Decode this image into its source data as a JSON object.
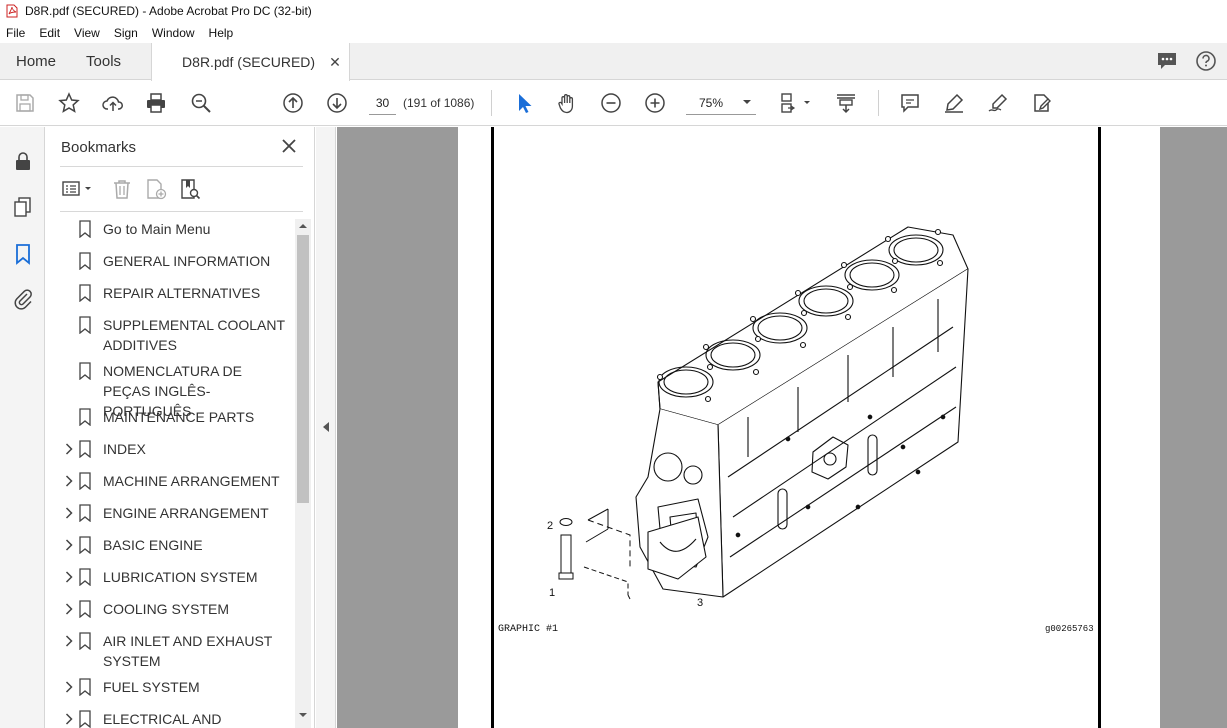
{
  "window": {
    "title": "D8R.pdf (SECURED) - Adobe Acrobat Pro DC (32-bit)"
  },
  "menu": [
    "File",
    "Edit",
    "View",
    "Sign",
    "Window",
    "Help"
  ],
  "tabs": {
    "home": "Home",
    "tools": "Tools",
    "document": "D8R.pdf (SECURED)"
  },
  "toolbar": {
    "page_number": "30",
    "page_count": "(191 of 1086)",
    "zoom": "75%"
  },
  "bookmarks": {
    "title": "Bookmarks",
    "items": [
      {
        "label": "Go to Main Menu",
        "expandable": false
      },
      {
        "label": "GENERAL INFORMATION",
        "expandable": false
      },
      {
        "label": "REPAIR ALTERNATIVES",
        "expandable": false
      },
      {
        "label": "SUPPLEMENTAL COOLANT ADDITIVES",
        "expandable": false
      },
      {
        "label": "NOMENCLATURA DE PEÇAS INGLÊS-PORTUGUÊS",
        "expandable": false
      },
      {
        "label": "MAINTENANCE PARTS",
        "expandable": false
      },
      {
        "label": "INDEX",
        "expandable": true
      },
      {
        "label": "MACHINE ARRANGEMENT",
        "expandable": true
      },
      {
        "label": "ENGINE ARRANGEMENT",
        "expandable": true
      },
      {
        "label": "BASIC ENGINE",
        "expandable": true
      },
      {
        "label": "LUBRICATION SYSTEM",
        "expandable": true
      },
      {
        "label": "COOLING SYSTEM",
        "expandable": true
      },
      {
        "label": "AIR INLET AND EXHAUST SYSTEM",
        "expandable": true
      },
      {
        "label": "FUEL SYSTEM",
        "expandable": true
      },
      {
        "label": "ELECTRICAL AND STARTING",
        "expandable": true
      }
    ]
  },
  "document": {
    "graphic_label": "GRAPHIC #1",
    "graphic_id": "g00265763",
    "callouts": {
      "c1": "1",
      "c2": "2",
      "c3": "3"
    }
  }
}
